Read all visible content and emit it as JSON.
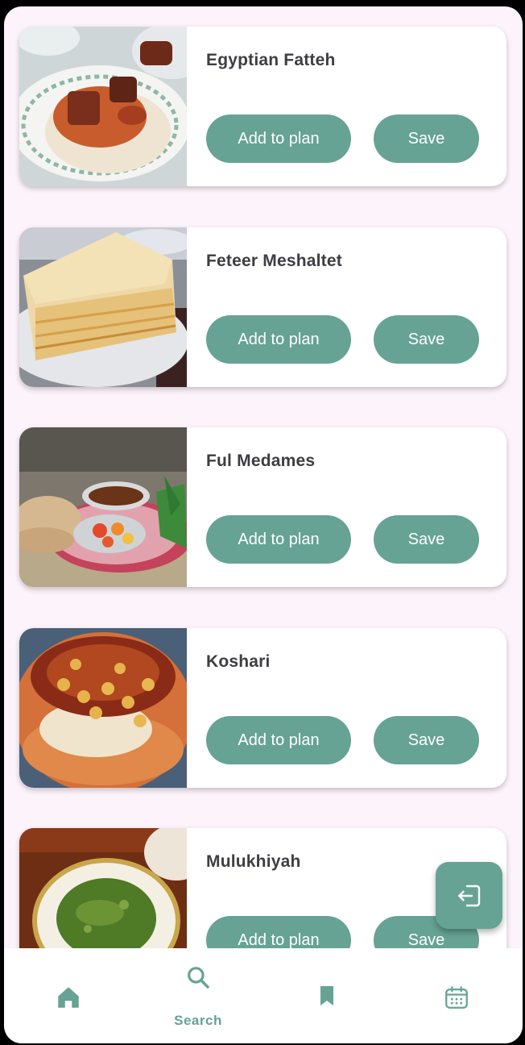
{
  "recipes": [
    {
      "name": "Egyptian Fatteh",
      "add_label": "Add to plan",
      "save_label": "Save"
    },
    {
      "name": "Feteer Meshaltet",
      "add_label": "Add to plan",
      "save_label": "Save"
    },
    {
      "name": "Ful Medames",
      "add_label": "Add to plan",
      "save_label": "Save"
    },
    {
      "name": "Koshari",
      "add_label": "Add to plan",
      "save_label": "Save"
    },
    {
      "name": "Mulukhiyah",
      "add_label": "Add to plan",
      "save_label": "Save"
    }
  ],
  "nav": {
    "items": [
      {
        "icon": "home-icon",
        "label": ""
      },
      {
        "icon": "search-icon",
        "label": "Search",
        "active": true
      },
      {
        "icon": "bookmark-icon",
        "label": ""
      },
      {
        "icon": "calendar-icon",
        "label": ""
      }
    ]
  },
  "fab": {
    "icon": "logout-icon"
  },
  "colors": {
    "accent": "#66a394",
    "background": "#fcf3fb",
    "title_text": "#3d3d44"
  }
}
